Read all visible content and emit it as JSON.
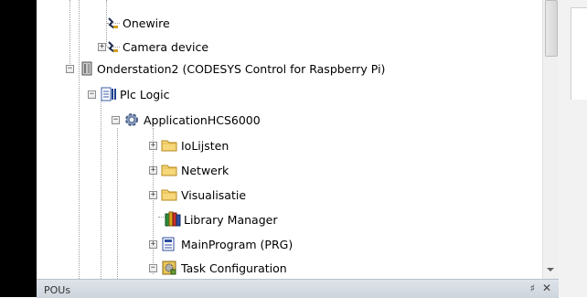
{
  "tree": {
    "items": [
      {
        "label": "Onewire",
        "icon": "device-icon",
        "expander": ""
      },
      {
        "label": "Camera device",
        "icon": "device-icon",
        "expander": "+"
      },
      {
        "label": "Onderstation2 (CODESYS Control for Raspberry Pi)",
        "icon": "controller-icon",
        "expander": "−"
      },
      {
        "label": "Plc Logic",
        "icon": "plc-logic-icon",
        "expander": "−"
      },
      {
        "label": "ApplicationHCS6000",
        "icon": "application-gear-icon",
        "expander": "−"
      },
      {
        "label": "IoLijsten",
        "icon": "folder-icon",
        "expander": "+"
      },
      {
        "label": "Netwerk",
        "icon": "folder-icon",
        "expander": "+"
      },
      {
        "label": "Visualisatie",
        "icon": "folder-icon",
        "expander": "+"
      },
      {
        "label": "Library Manager",
        "icon": "library-books-icon",
        "expander": ""
      },
      {
        "label": "MainProgram (PRG)",
        "icon": "program-icon",
        "expander": "+"
      },
      {
        "label": "Task Configuration",
        "icon": "task-config-icon",
        "expander": "−"
      }
    ]
  },
  "bottom_panel": {
    "title": "POUs",
    "pin": "♯",
    "close": "✕"
  }
}
